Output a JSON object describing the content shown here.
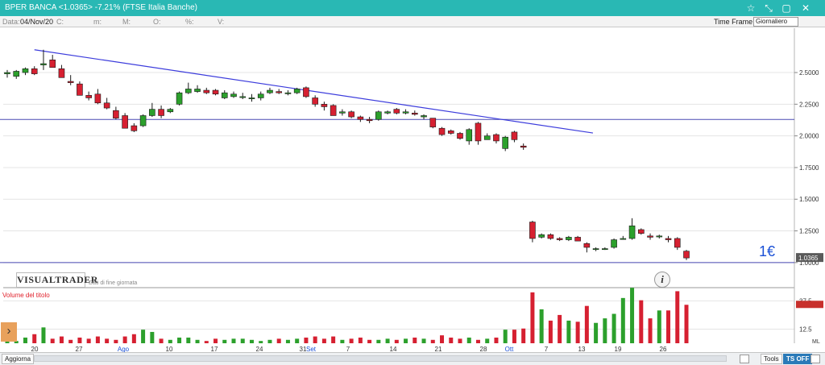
{
  "window": {
    "title": "BPER BANCA <1.0365> -7.21%  (FTSE Italia Banche)",
    "buttons": [
      "☆",
      "⤡",
      "▢",
      "✕"
    ]
  },
  "infobar": {
    "date_label": "Data:",
    "date_value": "04/Nov/20",
    "fields": [
      "C:",
      "m:",
      "M:",
      "O:",
      "%:",
      "V:"
    ],
    "timeframe_label": "Time Frame",
    "timeframe_value": "Giornaliero"
  },
  "brand": {
    "name": "VISUALTRADER",
    "note": "Dati di fine giornata"
  },
  "price_annotation": "1€",
  "current_price_label": "1.0365",
  "volume_title": "Volume del titolo",
  "footer": {
    "update": "Aggiorna",
    "tools": "Tools",
    "tsoff": "TS OFF"
  },
  "colors": {
    "up": "#2ca02c",
    "down": "#d62031",
    "trendline": "#3c3cdc",
    "hline": "#4a4ab4",
    "annotation": "#1a50d6"
  },
  "chart_data": {
    "type": "candlestick",
    "x_axis_labels": [
      "20",
      "27",
      "Ago",
      "10",
      "17",
      "24",
      "31",
      "Set",
      "7",
      "14",
      "21",
      "28",
      "Ott",
      "7",
      "13",
      "19",
      "26"
    ],
    "y_axis": {
      "ticks": [
        2.5,
        2.25,
        2.0,
        1.75,
        1.5,
        1.25,
        1.0
      ],
      "labels": [
        "2.5000",
        "2.2500",
        "2.0000",
        "1.7500",
        "1.5000",
        "1.2500",
        "1.0000"
      ],
      "range": [
        0.98,
        2.85
      ]
    },
    "volume_axis": {
      "ticks": [
        37.5,
        12.5
      ],
      "labels": [
        "37.5",
        "12.5"
      ],
      "range": [
        0,
        52
      ]
    },
    "volume_scale_label": "ML",
    "horizontal_lines": [
      2.13,
      1.0
    ],
    "trendline": {
      "from": {
        "date": "2020-07-21",
        "price": 2.68
      },
      "to": {
        "date": "2020-09-30",
        "price": 2.02
      }
    },
    "candles": [
      {
        "date": "2020-07-16",
        "o": 2.49,
        "h": 2.52,
        "l": 2.46,
        "c": 2.5,
        "v": 3
      },
      {
        "date": "2020-07-17",
        "o": 2.47,
        "h": 2.52,
        "l": 2.45,
        "c": 2.51,
        "v": 2
      },
      {
        "date": "2020-07-20",
        "o": 2.5,
        "h": 2.54,
        "l": 2.48,
        "c": 2.53,
        "v": 5
      },
      {
        "date": "2020-07-21",
        "o": 2.53,
        "h": 2.55,
        "l": 2.48,
        "c": 2.49,
        "v": 8
      },
      {
        "date": "2020-07-22",
        "o": 2.56,
        "h": 2.68,
        "l": 2.52,
        "c": 2.57,
        "v": 14
      },
      {
        "date": "2020-07-23",
        "o": 2.6,
        "h": 2.64,
        "l": 2.54,
        "c": 2.54,
        "v": 4
      },
      {
        "date": "2020-07-24",
        "o": 2.53,
        "h": 2.56,
        "l": 2.46,
        "c": 2.46,
        "v": 6
      },
      {
        "date": "2020-07-27",
        "o": 2.43,
        "h": 2.48,
        "l": 2.4,
        "c": 2.42,
        "v": 3
      },
      {
        "date": "2020-07-28",
        "o": 2.41,
        "h": 2.43,
        "l": 2.32,
        "c": 2.32,
        "v": 5
      },
      {
        "date": "2020-07-29",
        "o": 2.32,
        "h": 2.35,
        "l": 2.28,
        "c": 2.3,
        "v": 4
      },
      {
        "date": "2020-07-30",
        "o": 2.33,
        "h": 2.37,
        "l": 2.25,
        "c": 2.26,
        "v": 6
      },
      {
        "date": "2020-07-31",
        "o": 2.26,
        "h": 2.3,
        "l": 2.21,
        "c": 2.22,
        "v": 4
      },
      {
        "date": "2020-08-03",
        "o": 2.2,
        "h": 2.23,
        "l": 2.13,
        "c": 2.14,
        "v": 3
      },
      {
        "date": "2020-08-04",
        "o": 2.16,
        "h": 2.18,
        "l": 2.06,
        "c": 2.06,
        "v": 6
      },
      {
        "date": "2020-08-05",
        "o": 2.08,
        "h": 2.1,
        "l": 2.03,
        "c": 2.04,
        "v": 8
      },
      {
        "date": "2020-08-06",
        "o": 2.08,
        "h": 2.17,
        "l": 2.07,
        "c": 2.16,
        "v": 12
      },
      {
        "date": "2020-08-07",
        "o": 2.16,
        "h": 2.26,
        "l": 2.15,
        "c": 2.21,
        "v": 10
      },
      {
        "date": "2020-08-10",
        "o": 2.21,
        "h": 2.24,
        "l": 2.14,
        "c": 2.16,
        "v": 4
      },
      {
        "date": "2020-08-11",
        "o": 2.19,
        "h": 2.22,
        "l": 2.18,
        "c": 2.21,
        "v": 3
      },
      {
        "date": "2020-08-12",
        "o": 2.25,
        "h": 2.35,
        "l": 2.24,
        "c": 2.34,
        "v": 5
      },
      {
        "date": "2020-08-13",
        "o": 2.34,
        "h": 2.42,
        "l": 2.33,
        "c": 2.37,
        "v": 5
      },
      {
        "date": "2020-08-14",
        "o": 2.35,
        "h": 2.4,
        "l": 2.34,
        "c": 2.37,
        "v": 3
      },
      {
        "date": "2020-08-17",
        "o": 2.36,
        "h": 2.38,
        "l": 2.33,
        "c": 2.34,
        "v": 2
      },
      {
        "date": "2020-08-18",
        "o": 2.36,
        "h": 2.37,
        "l": 2.32,
        "c": 2.33,
        "v": 4
      },
      {
        "date": "2020-08-19",
        "o": 2.3,
        "h": 2.36,
        "l": 2.29,
        "c": 2.34,
        "v": 3
      },
      {
        "date": "2020-08-20",
        "o": 2.31,
        "h": 2.35,
        "l": 2.3,
        "c": 2.33,
        "v": 4
      },
      {
        "date": "2020-08-21",
        "o": 2.31,
        "h": 2.34,
        "l": 2.29,
        "c": 2.31,
        "v": 4
      },
      {
        "date": "2020-08-24",
        "o": 2.3,
        "h": 2.33,
        "l": 2.27,
        "c": 2.3,
        "v": 3
      },
      {
        "date": "2020-08-25",
        "o": 2.3,
        "h": 2.35,
        "l": 2.28,
        "c": 2.33,
        "v": 2
      },
      {
        "date": "2020-08-26",
        "o": 2.34,
        "h": 2.38,
        "l": 2.33,
        "c": 2.36,
        "v": 3
      },
      {
        "date": "2020-08-27",
        "o": 2.35,
        "h": 2.37,
        "l": 2.33,
        "c": 2.34,
        "v": 4
      },
      {
        "date": "2020-08-28",
        "o": 2.34,
        "h": 2.36,
        "l": 2.32,
        "c": 2.34,
        "v": 3
      },
      {
        "date": "2020-08-31",
        "o": 2.34,
        "h": 2.38,
        "l": 2.33,
        "c": 2.37,
        "v": 4
      },
      {
        "date": "2020-09-01",
        "o": 2.38,
        "h": 2.39,
        "l": 2.3,
        "c": 2.31,
        "v": 5
      },
      {
        "date": "2020-09-02",
        "o": 2.3,
        "h": 2.32,
        "l": 2.23,
        "c": 2.25,
        "v": 6
      },
      {
        "date": "2020-09-03",
        "o": 2.25,
        "h": 2.27,
        "l": 2.2,
        "c": 2.23,
        "v": 4
      },
      {
        "date": "2020-09-04",
        "o": 2.24,
        "h": 2.25,
        "l": 2.16,
        "c": 2.16,
        "v": 6
      },
      {
        "date": "2020-09-07",
        "o": 2.18,
        "h": 2.21,
        "l": 2.16,
        "c": 2.19,
        "v": 3
      },
      {
        "date": "2020-09-08",
        "o": 2.19,
        "h": 2.2,
        "l": 2.14,
        "c": 2.15,
        "v": 4
      },
      {
        "date": "2020-09-09",
        "o": 2.15,
        "h": 2.16,
        "l": 2.11,
        "c": 2.13,
        "v": 5
      },
      {
        "date": "2020-09-10",
        "o": 2.13,
        "h": 2.15,
        "l": 2.1,
        "c": 2.12,
        "v": 3
      },
      {
        "date": "2020-09-11",
        "o": 2.13,
        "h": 2.2,
        "l": 2.12,
        "c": 2.19,
        "v": 3
      },
      {
        "date": "2020-09-14",
        "o": 2.18,
        "h": 2.2,
        "l": 2.17,
        "c": 2.19,
        "v": 4
      },
      {
        "date": "2020-09-15",
        "o": 2.21,
        "h": 2.22,
        "l": 2.17,
        "c": 2.18,
        "v": 3
      },
      {
        "date": "2020-09-16",
        "o": 2.18,
        "h": 2.21,
        "l": 2.17,
        "c": 2.19,
        "v": 4
      },
      {
        "date": "2020-09-17",
        "o": 2.18,
        "h": 2.2,
        "l": 2.16,
        "c": 2.17,
        "v": 5
      },
      {
        "date": "2020-09-18",
        "o": 2.15,
        "h": 2.17,
        "l": 2.13,
        "c": 2.16,
        "v": 4
      },
      {
        "date": "2020-09-21",
        "o": 2.14,
        "h": 2.14,
        "l": 2.06,
        "c": 2.07,
        "v": 3
      },
      {
        "date": "2020-09-22",
        "o": 2.06,
        "h": 2.07,
        "l": 2.0,
        "c": 2.01,
        "v": 7
      },
      {
        "date": "2020-09-23",
        "o": 2.04,
        "h": 2.05,
        "l": 2.01,
        "c": 2.02,
        "v": 5
      },
      {
        "date": "2020-09-24",
        "o": 2.02,
        "h": 2.03,
        "l": 1.97,
        "c": 1.98,
        "v": 4
      },
      {
        "date": "2020-09-25",
        "o": 1.96,
        "h": 2.06,
        "l": 1.93,
        "c": 2.05,
        "v": 5
      },
      {
        "date": "2020-09-28",
        "o": 2.1,
        "h": 2.11,
        "l": 1.93,
        "c": 1.96,
        "v": 3
      },
      {
        "date": "2020-09-29",
        "o": 1.97,
        "h": 2.02,
        "l": 1.97,
        "c": 2.0,
        "v": 4
      },
      {
        "date": "2020-09-30",
        "o": 2.01,
        "h": 2.02,
        "l": 1.94,
        "c": 1.96,
        "v": 5
      },
      {
        "date": "2020-10-01",
        "o": 1.9,
        "h": 2.0,
        "l": 1.88,
        "c": 1.99,
        "v": 12
      },
      {
        "date": "2020-10-02",
        "o": 2.03,
        "h": 2.04,
        "l": 1.95,
        "c": 1.97,
        "v": 12
      },
      {
        "date": "2020-10-05",
        "o": 1.92,
        "h": 1.94,
        "l": 1.89,
        "c": 1.91,
        "v": 13
      },
      {
        "date": "2020-10-06",
        "o": 1.32,
        "h": 1.33,
        "l": 1.16,
        "c": 1.19,
        "v": 45
      },
      {
        "date": "2020-10-07",
        "o": 1.2,
        "h": 1.23,
        "l": 1.19,
        "c": 1.22,
        "v": 30
      },
      {
        "date": "2020-10-08",
        "o": 1.22,
        "h": 1.23,
        "l": 1.18,
        "c": 1.19,
        "v": 20
      },
      {
        "date": "2020-10-09",
        "o": 1.19,
        "h": 1.2,
        "l": 1.17,
        "c": 1.18,
        "v": 25
      },
      {
        "date": "2020-10-12",
        "o": 1.18,
        "h": 1.21,
        "l": 1.17,
        "c": 1.2,
        "v": 20
      },
      {
        "date": "2020-10-13",
        "o": 1.2,
        "h": 1.21,
        "l": 1.17,
        "c": 1.17,
        "v": 19
      },
      {
        "date": "2020-10-14",
        "o": 1.15,
        "h": 1.16,
        "l": 1.08,
        "c": 1.12,
        "v": 33
      },
      {
        "date": "2020-10-15",
        "o": 1.11,
        "h": 1.12,
        "l": 1.09,
        "c": 1.11,
        "v": 18
      },
      {
        "date": "2020-10-16",
        "o": 1.11,
        "h": 1.12,
        "l": 1.1,
        "c": 1.11,
        "v": 22
      },
      {
        "date": "2020-10-19",
        "o": 1.12,
        "h": 1.19,
        "l": 1.11,
        "c": 1.18,
        "v": 26
      },
      {
        "date": "2020-10-20",
        "o": 1.19,
        "h": 1.21,
        "l": 1.18,
        "c": 1.19,
        "v": 40
      },
      {
        "date": "2020-10-21",
        "o": 1.19,
        "h": 1.35,
        "l": 1.18,
        "c": 1.29,
        "v": 49
      },
      {
        "date": "2020-10-22",
        "o": 1.26,
        "h": 1.27,
        "l": 1.22,
        "c": 1.23,
        "v": 38
      },
      {
        "date": "2020-10-23",
        "o": 1.21,
        "h": 1.23,
        "l": 1.18,
        "c": 1.2,
        "v": 22
      },
      {
        "date": "2020-10-26",
        "o": 1.21,
        "h": 1.22,
        "l": 1.19,
        "c": 1.21,
        "v": 29
      },
      {
        "date": "2020-10-27",
        "o": 1.19,
        "h": 1.21,
        "l": 1.16,
        "c": 1.18,
        "v": 29
      },
      {
        "date": "2020-10-28",
        "o": 1.19,
        "h": 1.2,
        "l": 1.1,
        "c": 1.12,
        "v": 46
      },
      {
        "date": "2020-10-29",
        "o": 1.09,
        "h": 1.1,
        "l": 1.02,
        "c": 1.0365,
        "v": 34
      }
    ]
  }
}
